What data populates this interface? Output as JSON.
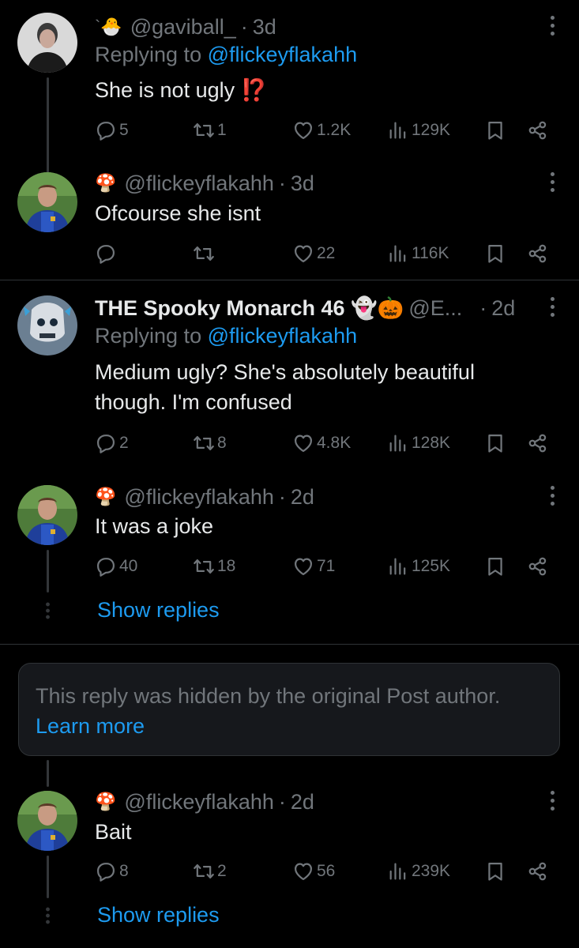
{
  "posts": [
    {
      "emoji": "`🐣",
      "display_name": "",
      "handle": "@gaviball_",
      "time": "3d",
      "replying_label": "Replying to",
      "replying_handle": "@flickeyflakahh",
      "text": "She is not ugly ⁉️",
      "replies": "5",
      "reposts": "1",
      "likes": "1.2K",
      "views": "129K"
    },
    {
      "emoji": "🍄",
      "display_name": "",
      "handle": "@flickeyflakahh",
      "time": "3d",
      "text": "Ofcourse she isnt",
      "replies": "",
      "reposts": "",
      "likes": "22",
      "views": "116K"
    },
    {
      "emoji": "",
      "display_name": "THE Spooky Monarch 46 👻🎃",
      "handle": "@E...",
      "time": "2d",
      "replying_label": "Replying to",
      "replying_handle": "@flickeyflakahh",
      "text": "Medium ugly?  She's absolutely beautiful though. I'm confused",
      "replies": "2",
      "reposts": "8",
      "likes": "4.8K",
      "views": "128K"
    },
    {
      "emoji": "🍄",
      "display_name": "",
      "handle": "@flickeyflakahh",
      "time": "2d",
      "text": "It was a joke",
      "replies": "40",
      "reposts": "18",
      "likes": "71",
      "views": "125K",
      "show_replies": "Show replies"
    },
    {
      "emoji": "🍄",
      "display_name": "",
      "handle": "@flickeyflakahh",
      "time": "2d",
      "text": "Bait",
      "replies": "8",
      "reposts": "2",
      "likes": "56",
      "views": "239K",
      "show_replies": "Show replies"
    }
  ],
  "hidden_notice": {
    "message": "This reply was hidden by the original Post author.",
    "link": "Learn more"
  },
  "colors": {
    "background": "#000000",
    "text": "#e7e9ea",
    "muted": "#71767b",
    "link": "#1d9bf0",
    "border": "#2f3336"
  },
  "icons": [
    "reply-icon",
    "repost-icon",
    "like-icon",
    "views-icon",
    "bookmark-icon",
    "share-icon",
    "more-icon"
  ]
}
